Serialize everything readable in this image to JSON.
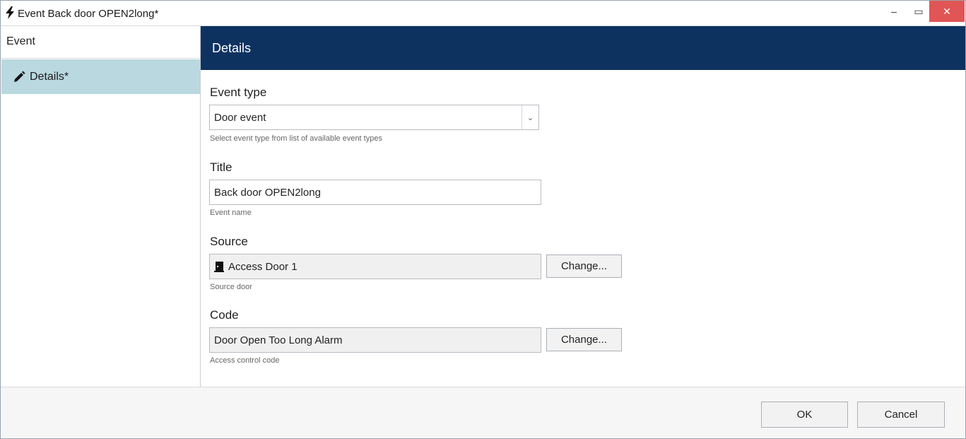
{
  "window": {
    "title": "Event Back door OPEN2long*",
    "icon": "lightning-icon",
    "controls": {
      "minimize": "–",
      "maximize": "▭",
      "close": "✕"
    }
  },
  "sidebar": {
    "header": "Event",
    "items": [
      {
        "label": "Details*",
        "icon": "pencil-icon",
        "selected": true
      }
    ]
  },
  "content": {
    "header_title": "Details",
    "event_type": {
      "label": "Event type",
      "value": "Door event",
      "hint": "Select event type from list of available event types"
    },
    "title": {
      "label": "Title",
      "value": "Back door OPEN2long",
      "hint": "Event name"
    },
    "source": {
      "label": "Source",
      "value": "Access Door 1",
      "icon": "door-icon",
      "hint": "Source door",
      "change_label": "Change..."
    },
    "code": {
      "label": "Code",
      "value": "Door Open Too Long Alarm",
      "hint": "Access control code",
      "change_label": "Change..."
    }
  },
  "footer": {
    "ok_label": "OK",
    "cancel_label": "Cancel"
  },
  "colors": {
    "header_bg": "#0e3260",
    "selected_item_bg": "#b9d8e0",
    "close_button": "#e05555"
  }
}
